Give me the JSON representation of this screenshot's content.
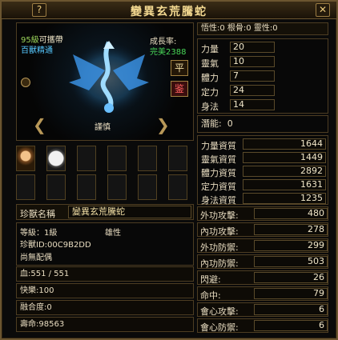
{
  "window": {
    "title": "變異玄荒騰蛇",
    "help_icon": "?",
    "close_icon": "✕"
  },
  "portrait": {
    "level_label": "95級",
    "level_req": "可攜帶",
    "skill_label": "百獸精通",
    "growth_label": "成長率:",
    "growth_value": "完美2388",
    "button_ping": "平",
    "button_jian": "鉴",
    "temperament": "謹慎"
  },
  "top_stats": {
    "text": "悟性:0 根骨:0 靈性:0"
  },
  "attributes": [
    {
      "label": "力量",
      "value": "20"
    },
    {
      "label": "靈氣",
      "value": "10"
    },
    {
      "label": "體力",
      "value": "7"
    },
    {
      "label": "定力",
      "value": "24"
    },
    {
      "label": "身法",
      "value": "14"
    }
  ],
  "potential": {
    "label": "潛能:",
    "value": "0"
  },
  "aptitudes": [
    {
      "label": "力量資質",
      "value": "1644"
    },
    {
      "label": "靈氣資質",
      "value": "1449"
    },
    {
      "label": "體力資質",
      "value": "2892"
    },
    {
      "label": "定力資質",
      "value": "1631"
    },
    {
      "label": "身法資質",
      "value": "1235"
    }
  ],
  "pet_name": {
    "label": "珍獸名稱",
    "value": "變異玄荒騰蛇"
  },
  "info": {
    "level": "等級：1級",
    "gender": "雄性",
    "id": "珍獸ID:00C9B2DD",
    "spouse": "尚無配偶"
  },
  "blood": "血:551 / 551",
  "happiness": "快樂:100",
  "fusion": "融合度:0",
  "lifespan": "壽命:98563",
  "combat": [
    {
      "label": "外功攻擊:",
      "value": "480"
    },
    {
      "label": "內功攻擊:",
      "value": "278"
    },
    {
      "label": "外功防禦:",
      "value": "299"
    },
    {
      "label": "內功防禦:",
      "value": "503"
    },
    {
      "label": "閃避:",
      "value": "26"
    },
    {
      "label": "命中:",
      "value": "79"
    },
    {
      "label": "會心攻擊:",
      "value": "6"
    },
    {
      "label": "會心防禦:",
      "value": "6"
    }
  ],
  "colors": {
    "gold": "#f3d890",
    "green": "#48d858",
    "blue": "#56c8ff",
    "border": "#6b5530"
  }
}
